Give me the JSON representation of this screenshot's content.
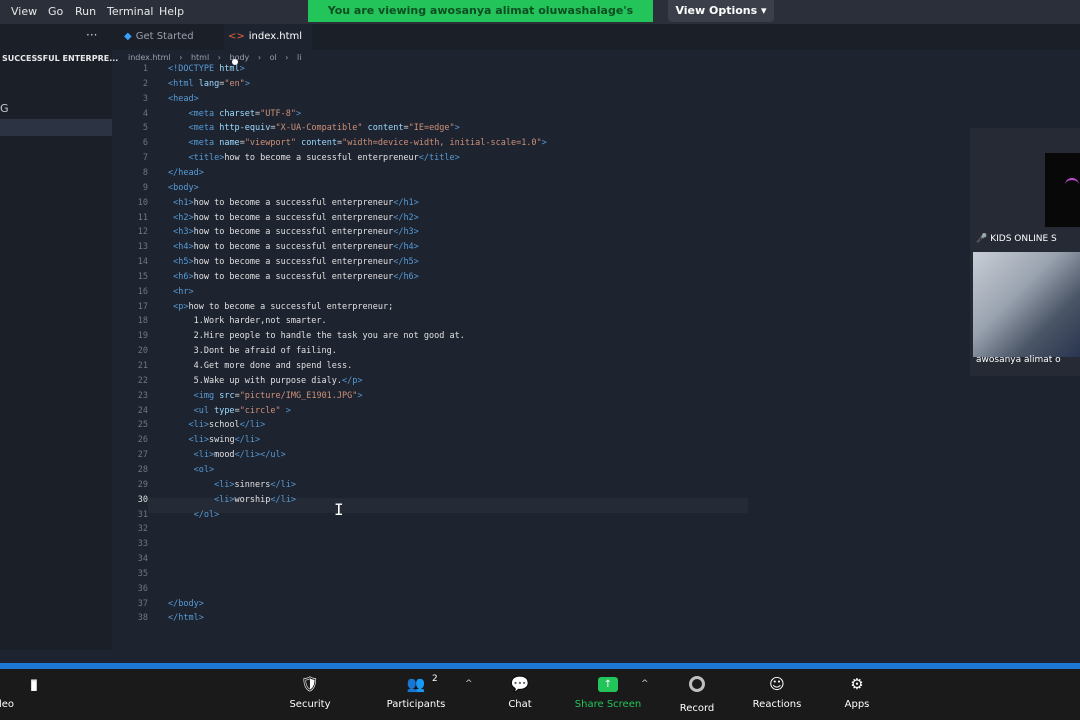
{
  "menubar": {
    "items": [
      "View",
      "Go",
      "Run",
      "Terminal",
      "Help"
    ],
    "share_banner": "You are viewing awosanya alimat oluwashalage's screen",
    "view_options": "View Options ▾"
  },
  "sidebar": {
    "more": "···",
    "folder": "SUCCESSFUL ENTERPRE...",
    "item": "G"
  },
  "tabs": [
    {
      "label": "Get Started"
    },
    {
      "label": "index.html"
    }
  ],
  "breadcrumb": [
    "index.html",
    "html",
    "body",
    "ol",
    "li"
  ],
  "editor": {
    "lines": [
      {
        "n": "1",
        "html": "<span class=\"tag\">&lt;!DOCTYPE</span> <span class=\"attr\">html</span><span class=\"tag\">&gt;</span>"
      },
      {
        "n": "2",
        "html": "<span class=\"tag\">&lt;html</span> <span class=\"attr\">lang</span>=<span class=\"str\">\"en\"</span><span class=\"tag\">&gt;</span>"
      },
      {
        "n": "3",
        "html": "<span class=\"tag\">&lt;head&gt;</span>"
      },
      {
        "n": "4",
        "html": "    <span class=\"tag\">&lt;meta</span> <span class=\"attr\">charset</span>=<span class=\"str\">\"UTF-8\"</span><span class=\"tag\">&gt;</span>"
      },
      {
        "n": "5",
        "html": "    <span class=\"tag\">&lt;meta</span> <span class=\"attr\">http-equiv</span>=<span class=\"str\">\"X-UA-Compatible\"</span> <span class=\"attr\">content</span>=<span class=\"str\">\"IE=edge\"</span><span class=\"tag\">&gt;</span>"
      },
      {
        "n": "6",
        "html": "    <span class=\"tag\">&lt;meta</span> <span class=\"attr\">name</span>=<span class=\"str\">\"viewport\"</span> <span class=\"attr\">content</span>=<span class=\"str\">\"width=device-width, initial-scale=1.0\"</span><span class=\"tag\">&gt;</span>"
      },
      {
        "n": "7",
        "html": "    <span class=\"tag\">&lt;title&gt;</span><span class=\"txt\">how to become a sucessful enterpreneur</span><span class=\"tag\">&lt;/title&gt;</span>"
      },
      {
        "n": "8",
        "html": "<span class=\"tag\">&lt;/head&gt;</span>"
      },
      {
        "n": "9",
        "html": "<span class=\"tag\">&lt;body&gt;</span>"
      },
      {
        "n": "10",
        "html": " <span class=\"tag\">&lt;h1&gt;</span><span class=\"txt\">how to become a successful enterpreneur</span><span class=\"tag\">&lt;/h1&gt;</span>"
      },
      {
        "n": "11",
        "html": " <span class=\"tag\">&lt;h2&gt;</span><span class=\"txt\">how to become a successful enterpreneur</span><span class=\"tag\">&lt;/h2&gt;</span>"
      },
      {
        "n": "12",
        "html": " <span class=\"tag\">&lt;h3&gt;</span><span class=\"txt\">how to become a successful enterpreneur</span><span class=\"tag\">&lt;/h3&gt;</span>"
      },
      {
        "n": "13",
        "html": " <span class=\"tag\">&lt;h4&gt;</span><span class=\"txt\">how to become a successful enterpreneur</span><span class=\"tag\">&lt;/h4&gt;</span>"
      },
      {
        "n": "14",
        "html": " <span class=\"tag\">&lt;h5&gt;</span><span class=\"txt\">how to become a successful enterpreneur</span><span class=\"tag\">&lt;/h5&gt;</span>"
      },
      {
        "n": "15",
        "html": " <span class=\"tag\">&lt;h6&gt;</span><span class=\"txt\">how to become a successful enterpreneur</span><span class=\"tag\">&lt;/h6&gt;</span>"
      },
      {
        "n": "16",
        "html": " <span class=\"tag\">&lt;hr&gt;</span>"
      },
      {
        "n": "17",
        "html": " <span class=\"tag\">&lt;p&gt;</span><span class=\"txt\">how to become a successful enterpreneur;</span>"
      },
      {
        "n": "18",
        "html": "     <span class=\"txt\">1.Work harder,not smarter.</span>"
      },
      {
        "n": "19",
        "html": "     <span class=\"txt\">2.Hire people to handle the task you are not good at.</span>"
      },
      {
        "n": "20",
        "html": "     <span class=\"txt\">3.Dont be afraid of failing.</span>"
      },
      {
        "n": "21",
        "html": "     <span class=\"txt\">4.Get more done and spend less.</span>"
      },
      {
        "n": "22",
        "html": "     <span class=\"txt\">5.Wake up with purpose dialy.</span><span class=\"tag\">&lt;/p&gt;</span>"
      },
      {
        "n": "23",
        "html": "     <span class=\"tag\">&lt;img</span> <span class=\"attr\">src</span>=<span class=\"str\">\"picture/IMG_E1901.JPG\"</span><span class=\"tag\">&gt;</span>"
      },
      {
        "n": "24",
        "html": "     <span class=\"tag\">&lt;ul</span> <span class=\"attr\">type</span>=<span class=\"str\">\"circle\"</span> <span class=\"tag\">&gt;</span>"
      },
      {
        "n": "25",
        "html": "    <span class=\"tag\">&lt;li&gt;</span><span class=\"txt\">school</span><span class=\"tag\">&lt;/li&gt;</span>"
      },
      {
        "n": "26",
        "html": "    <span class=\"tag\">&lt;li&gt;</span><span class=\"txt\">swing</span><span class=\"tag\">&lt;/li&gt;</span>"
      },
      {
        "n": "27",
        "html": "     <span class=\"tag\">&lt;li&gt;</span><span class=\"txt\">mood</span><span class=\"tag\">&lt;/li&gt;&lt;/ul&gt;</span>"
      },
      {
        "n": "28",
        "html": "     <span class=\"tag\">&lt;ol&gt;</span>"
      },
      {
        "n": "29",
        "html": "         <span class=\"tag\">&lt;li&gt;</span><span class=\"txt\">sinners</span><span class=\"tag\">&lt;/li&gt;</span>"
      },
      {
        "n": "30",
        "html": "         <span class=\"tag\">&lt;li&gt;</span><span class=\"txt\">worship</span><span class=\"tag\">&lt;/li&gt;</span>"
      },
      {
        "n": "31",
        "html": "     <span class=\"tag\">&lt;/ol&gt;</span>"
      },
      {
        "n": "32",
        "html": ""
      },
      {
        "n": "33",
        "html": ""
      },
      {
        "n": "34",
        "html": ""
      },
      {
        "n": "35",
        "html": ""
      },
      {
        "n": "36",
        "html": ""
      },
      {
        "n": "37",
        "html": "<span class=\"tag\">&lt;/body&gt;</span>"
      },
      {
        "n": "38",
        "html": "<span class=\"tag\">&lt;/html&gt;</span>"
      }
    ],
    "active_line": "30"
  },
  "video": {
    "kids_label": "KIDS ONLINE S",
    "participant_name": "awosanya alimat o"
  },
  "toolbar": {
    "video_label": "Video",
    "security_label": "Security",
    "participants_label": "Participants",
    "participants_count": "2",
    "chat_label": "Chat",
    "share_label": "Share Screen",
    "record_label": "Record",
    "reactions_label": "Reactions",
    "apps_label": "Apps"
  },
  "colors": {
    "share_green": "#23c45a",
    "zoom_blue": "#1f77d4",
    "tag_blue": "#569cd6",
    "string_orange": "#ce9178"
  }
}
